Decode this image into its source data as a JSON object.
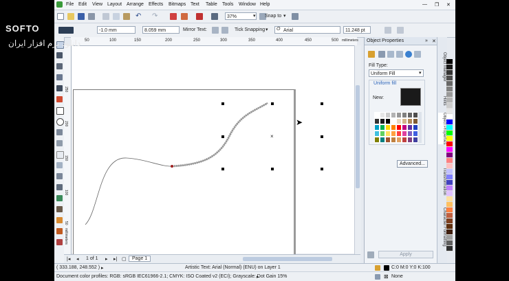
{
  "watermark": {
    "brand": "SOFTO",
    "subtitle": "دانلود نرم افزار ایران"
  },
  "menu": {
    "items": [
      "File",
      "Edit",
      "View",
      "Layout",
      "Arrange",
      "Effects",
      "Bitmaps",
      "Text",
      "Table",
      "Tools",
      "Window",
      "Help"
    ]
  },
  "window_controls": {
    "minimize": "—",
    "restore": "❐",
    "close": "✕"
  },
  "toolbar1": {
    "zoom": "37%",
    "snap_to": "Snap to"
  },
  "toolbar2": {
    "x_field": "-1.0 mm",
    "width_field": "8.059 mm",
    "mirror_text": "Mirror Text:",
    "tick_snapping": "Tick Snapping",
    "font": "Arial",
    "font_size": "11.248 pt"
  },
  "ruler": {
    "h_ticks": [
      "50",
      "100",
      "150",
      "200",
      "250",
      "300",
      "350",
      "400",
      "450",
      "500"
    ],
    "unit": "millimeters",
    "v_ticks": [
      "250",
      "200",
      "150",
      "100",
      "50"
    ],
    "v_unit": "millimeters"
  },
  "docker": {
    "title": "Object Properties",
    "fill_type_label": "Fill Type:",
    "fill_type_value": "Uniform Fill",
    "uniform_fill_label": "Uniform fill",
    "new_label": "New:",
    "advanced_button": "Advanced...",
    "apply_button": "Apply",
    "new_color": "#1a1a1a",
    "swatches": [
      "#ffffff",
      "#e6e6e6",
      "#cccccc",
      "#b3b3b3",
      "#999999",
      "#808080",
      "#666666",
      "#4d4d4d",
      "#333333",
      "#1a1a1a",
      "#000000",
      "#ffffff",
      "#e8d9c4",
      "#d4b48c",
      "#b38b5a",
      "#7f5a32",
      "#00a0c6",
      "#00b050",
      "#ffd700",
      "#ff7f00",
      "#ff0000",
      "#c00080",
      "#6030a0",
      "#2040c0",
      "#40c0e0",
      "#60d060",
      "#ffe060",
      "#ffa040",
      "#ff4040",
      "#e040a0",
      "#8060c0",
      "#4060e0",
      "#808000",
      "#008080",
      "#a0522d",
      "#c08040",
      "#e0a060",
      "#c04040",
      "#804080",
      "#4040a0"
    ]
  },
  "side_tabs": [
    "Object Manager",
    "Hints",
    "Object Properties",
    "Transformation",
    "Character Formatting"
  ],
  "palette": [
    "#000000",
    "#1a1a1a",
    "#333333",
    "#4d4d4d",
    "#666666",
    "#808080",
    "#999999",
    "#b3b3b3",
    "#cccccc",
    "#e6e6e6",
    "#ffffff",
    "#0000ff",
    "#00ffff",
    "#00ff00",
    "#ffff00",
    "#ff0000",
    "#ff00ff",
    "#800080",
    "#ff8080",
    "#ffc0c0",
    "#c0c0ff",
    "#8080ff",
    "#4040c0",
    "#c080ff",
    "#e0c0ff",
    "#ffe0a0",
    "#ffc060",
    "#ff8040",
    "#c06040",
    "#804020",
    "#603010",
    "#402010",
    "#a0a0a0",
    "#606060",
    "#303030"
  ],
  "pages": {
    "counter": "1 of 1",
    "tab": "Page 1"
  },
  "status": {
    "coords": "( 333.188, 248.552 )",
    "object_info": "Artistic Text: Arial (Normal) (ENU) on Layer 1",
    "color_profiles": "Document color profiles: RGB: sRGB IEC61966-2.1; CMYK: ISO Coated v2 (ECI); Grayscale: Dot Gain 15%",
    "fill_info": "C:0 M:0 Y:0 K:100",
    "outline_info": "None"
  }
}
